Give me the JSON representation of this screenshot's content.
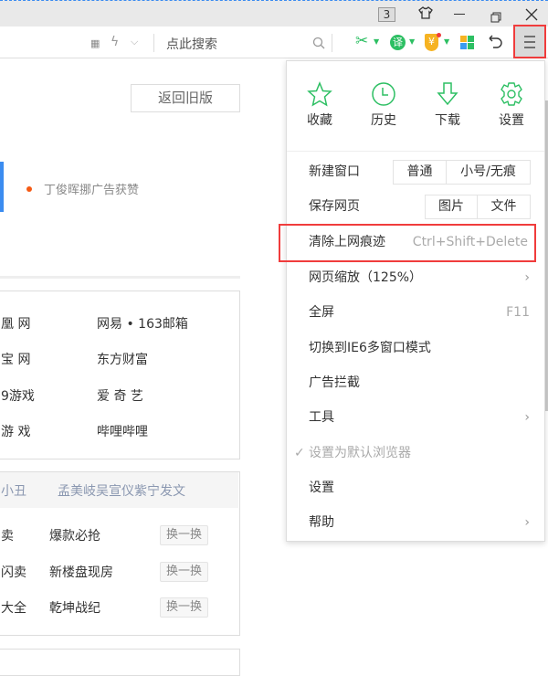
{
  "titlebar": {
    "tab_count": "3"
  },
  "toolbar": {
    "search_placeholder": "点此搜索",
    "translate_label": "译",
    "shield_label": "¥"
  },
  "page": {
    "old_version_button": "返回旧版",
    "news_item": "丁俊晖挪广告获赞",
    "sites": [
      [
        "凰 网",
        "网易 • 163邮箱"
      ],
      [
        "宝 网",
        "东方财富"
      ],
      [
        "9游戏",
        "爱 奇 艺"
      ],
      [
        "游 戏",
        "哔哩哔哩"
      ]
    ],
    "hot_header": [
      "小丑",
      "孟美岐吴宣仪紫宁发文"
    ],
    "hot_rows": [
      [
        "卖",
        "爆款必抢"
      ],
      [
        "闪卖",
        "新楼盘现房"
      ],
      [
        "大全",
        "乾坤战纪"
      ]
    ],
    "swap_label": "换一换"
  },
  "menu": {
    "quick": [
      {
        "label": "收藏",
        "icon": "star-icon"
      },
      {
        "label": "历史",
        "icon": "clock-icon"
      },
      {
        "label": "下载",
        "icon": "download-icon"
      },
      {
        "label": "设置",
        "icon": "gear-icon"
      }
    ],
    "new_window": {
      "label": "新建窗口",
      "options": [
        "普通",
        "小号/无痕"
      ]
    },
    "save_page": {
      "label": "保存网页",
      "options": [
        "图片",
        "文件"
      ]
    },
    "clear_history": {
      "label": "清除上网痕迹",
      "shortcut": "Ctrl+Shift+Delete"
    },
    "zoom": {
      "label": "网页缩放（125%）"
    },
    "fullscreen": {
      "label": "全屏",
      "shortcut": "F11"
    },
    "ie6_mode": {
      "label": "切换到IE6多窗口模式"
    },
    "adblock": {
      "label": "广告拦截"
    },
    "tools": {
      "label": "工具"
    },
    "default_browser": {
      "label": "设置为默认浏览器"
    },
    "settings": {
      "label": "设置"
    },
    "help": {
      "label": "帮助"
    }
  },
  "colors": {
    "accent_green": "#2dbf63",
    "highlight_red": "#f03c3c",
    "link_blue": "#3b8cf0"
  }
}
